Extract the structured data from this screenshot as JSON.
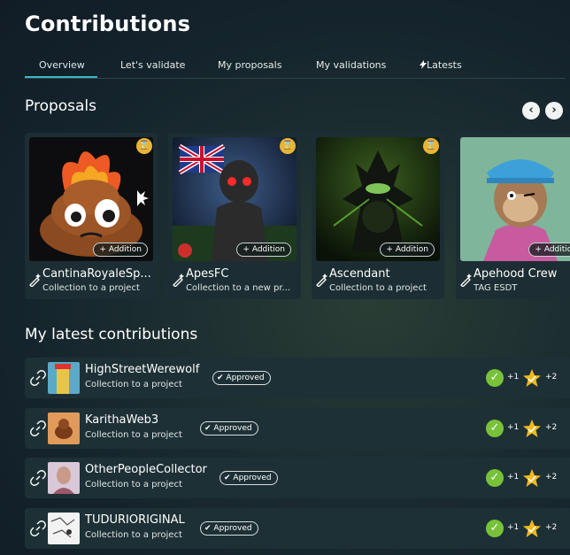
{
  "page_title": "Contributions",
  "tabs": [
    {
      "label": "Overview"
    },
    {
      "label": "Let's validate"
    },
    {
      "label": "My proposals"
    },
    {
      "label": "My validations"
    },
    {
      "label": "Latests",
      "icon": "lightning-icon"
    }
  ],
  "proposals": {
    "heading": "Proposals",
    "prev_icon": "‹",
    "next_icon": "›",
    "cards": [
      {
        "name": "CantinaRoyaleSp...",
        "subtitle": "Collection to a project",
        "badge": "+ Addition",
        "status_icon": "hourglass-icon"
      },
      {
        "name": "ApesFC",
        "subtitle": "Collection to a new pr...",
        "badge": "+ Addition",
        "status_icon": "hourglass-icon"
      },
      {
        "name": "Ascendant",
        "subtitle": "Collection to a project",
        "badge": "+ Addition",
        "status_icon": "hourglass-icon"
      },
      {
        "name": "Apehood Crew",
        "subtitle": "TAG ESDT",
        "badge": "+ Addition",
        "status_icon": "hourglass-icon"
      }
    ]
  },
  "latest": {
    "heading": "My latest contributions",
    "items": [
      {
        "name": "HighStreetWerewolf",
        "subtitle": "Collection to a project",
        "status": "Approved",
        "votes": "+1",
        "stars": "+2"
      },
      {
        "name": "KarithaWeb3",
        "subtitle": "Collection to a project",
        "status": "Approved",
        "votes": "+1",
        "stars": "+2"
      },
      {
        "name": "OtherPeopleCollector",
        "subtitle": "Collection to a project",
        "status": "Approved",
        "votes": "+1",
        "stars": "+2"
      },
      {
        "name": "TUDURIORIGINAL",
        "subtitle": "Collection to a project",
        "status": "Approved",
        "votes": "+1",
        "stars": "+2"
      }
    ]
  },
  "colors": {
    "accent": "#3fb8c4",
    "approve": "#78c23a",
    "star": "#f2b91c",
    "pending": "#e8b634"
  }
}
